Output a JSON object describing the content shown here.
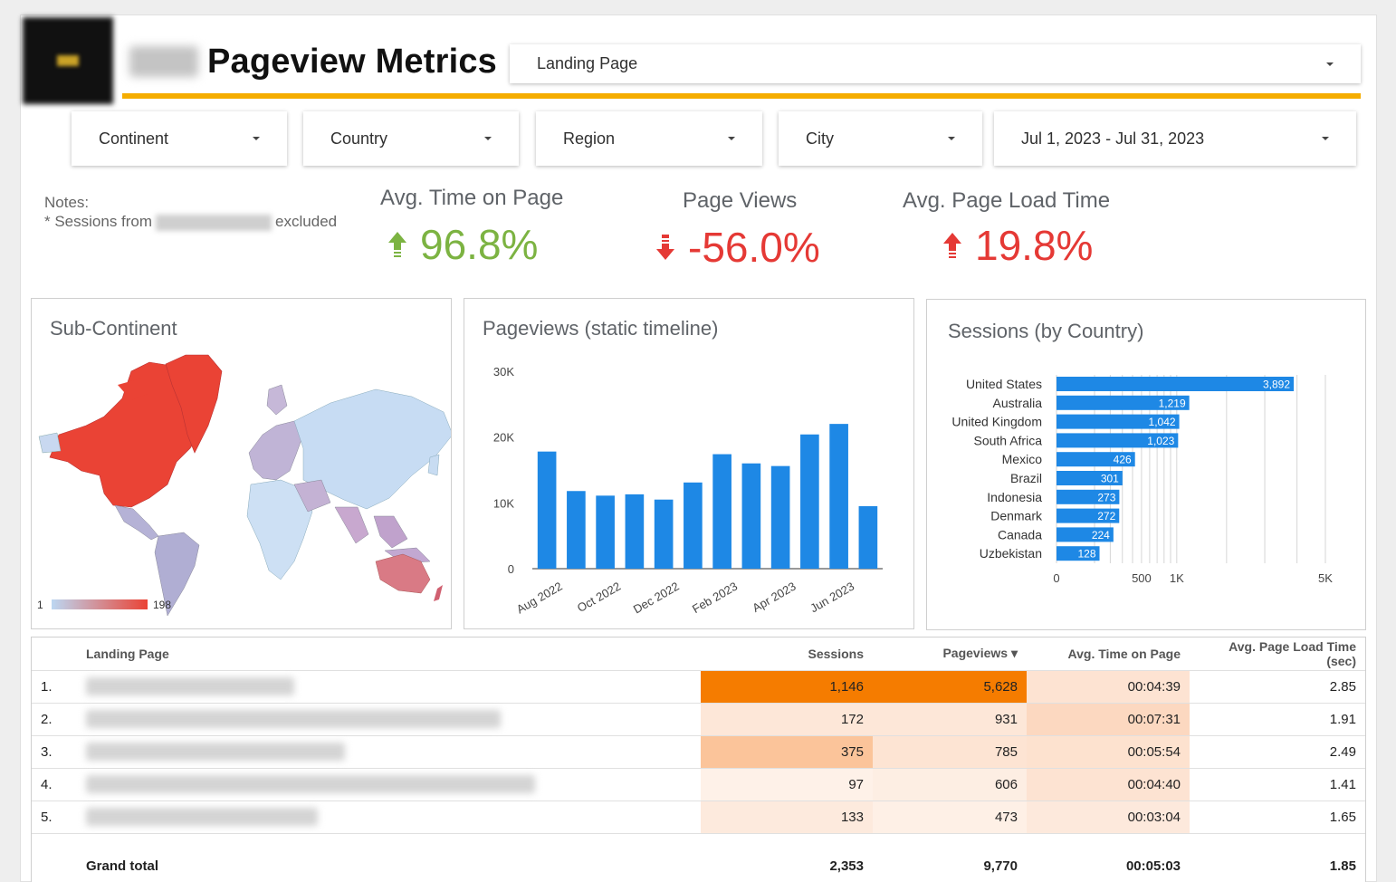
{
  "header": {
    "title": "Pageview Metrics"
  },
  "filters": {
    "landing_page": "Landing Page",
    "continent": "Continent",
    "country": "Country",
    "region": "Region",
    "city": "City",
    "date_range": "Jul 1, 2023 - Jul 31, 2023"
  },
  "notes": {
    "line1": "Notes:",
    "prefix": "* Sessions from",
    "suffix": "excluded"
  },
  "kpis": [
    {
      "label": "Avg. Time on Page",
      "value": "96.8%",
      "direction": "up",
      "color": "#7cb342"
    },
    {
      "label": "Page Views",
      "value": "-56.0%",
      "direction": "down",
      "color": "#e53935"
    },
    {
      "label": "Avg. Page Load Time",
      "value": "19.8%",
      "direction": "up",
      "color": "#e53935"
    }
  ],
  "map_panel": {
    "title": "Sub-Continent",
    "legend_min": "1",
    "legend_max": "198"
  },
  "colors": {
    "accent": "#f5ad00",
    "bar": "#1e88e5",
    "heat_dark": "#f57c00",
    "heat_mid": "#fbc49a",
    "heat_light": "#fde7d8"
  },
  "chart_data": [
    {
      "type": "bar",
      "title": "Pageviews (static timeline)",
      "categories": [
        "Aug 2022",
        "Sep 2022",
        "Oct 2022",
        "Nov 2022",
        "Dec 2022",
        "Jan 2023",
        "Feb 2023",
        "Mar 2023",
        "Apr 2023",
        "May 2023",
        "Jun 2023",
        "Jul 2023"
      ],
      "x_tick_labels": [
        "Aug 2022",
        "Oct 2022",
        "Dec 2022",
        "Feb 2023",
        "Apr 2023",
        "Jun 2023"
      ],
      "values": [
        17800,
        11800,
        11100,
        11300,
        10500,
        13100,
        17400,
        16000,
        15600,
        20400,
        22000,
        9500
      ],
      "y_ticks": [
        "0",
        "10K",
        "20K",
        "30K"
      ],
      "ylim": [
        0,
        30000
      ],
      "grid": false
    },
    {
      "type": "bar",
      "orientation": "horizontal",
      "title": "Sessions (by Country)",
      "categories": [
        "United States",
        "Australia",
        "United Kingdom",
        "South Africa",
        "Mexico",
        "Brazil",
        "Indonesia",
        "Denmark",
        "Canada",
        "Uzbekistan"
      ],
      "values": [
        3892,
        1219,
        1042,
        1023,
        426,
        301,
        273,
        272,
        224,
        128
      ],
      "labels": [
        "3,892",
        "1,219",
        "1,042",
        "1,023",
        "426",
        "301",
        "273",
        "272",
        "224",
        "128"
      ],
      "x_ticks": [
        "0",
        "500",
        "1K",
        "5K"
      ],
      "scale": "sqrt",
      "xlim": [
        0,
        5000
      ],
      "grid": true
    }
  ],
  "table": {
    "headers": {
      "landing_page": "Landing Page",
      "sessions": "Sessions",
      "pageviews": "Pageviews ▾",
      "avg_time": "Avg. Time on Page",
      "load_time": "Avg. Page Load Time (sec)"
    },
    "rows": [
      {
        "idx": "1.",
        "sessions": "1,146",
        "pageviews": "5,628",
        "avg_time": "00:04:39",
        "load_time": "2.85",
        "heat": [
          "dark",
          "dark",
          "light",
          "none"
        ]
      },
      {
        "idx": "2.",
        "sessions": "172",
        "pageviews": "931",
        "avg_time": "00:07:31",
        "load_time": "1.91",
        "heat": [
          "light",
          "light",
          "mid-light",
          "none"
        ]
      },
      {
        "idx": "3.",
        "sessions": "375",
        "pageviews": "785",
        "avg_time": "00:05:54",
        "load_time": "2.49",
        "heat": [
          "mid",
          "light",
          "light",
          "none"
        ]
      },
      {
        "idx": "4.",
        "sessions": "97",
        "pageviews": "606",
        "avg_time": "00:04:40",
        "load_time": "1.41",
        "heat": [
          "faint",
          "faint",
          "light",
          "none"
        ]
      },
      {
        "idx": "5.",
        "sessions": "133",
        "pageviews": "473",
        "avg_time": "00:03:04",
        "load_time": "1.65",
        "heat": [
          "light",
          "faint",
          "light",
          "none"
        ]
      }
    ],
    "total": {
      "label": "Grand total",
      "sessions": "2,353",
      "pageviews": "9,770",
      "avg_time": "00:05:03",
      "load_time": "1.85"
    }
  }
}
